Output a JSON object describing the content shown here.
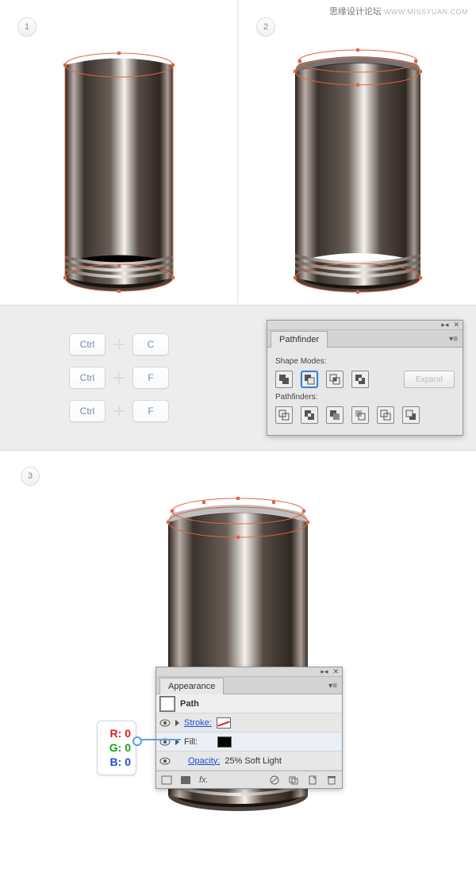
{
  "watermark": {
    "cn": "思缘设计论坛",
    "url": "WWW.MISSYUAN.COM"
  },
  "steps": {
    "one": "1",
    "two": "2",
    "three": "3"
  },
  "shortcuts": {
    "ctrl": "Ctrl",
    "c": "C",
    "f": "F"
  },
  "pathfinder": {
    "title": "Pathfinder",
    "shape_modes_label": "Shape Modes:",
    "pathfinders_label": "Pathfinders:",
    "expand": "Expand"
  },
  "appearance": {
    "title": "Appearance",
    "path": "Path",
    "stroke_label": "Stroke:",
    "fill_label": "Fill:",
    "opacity_label": "Opacity:",
    "opacity_value": "25% Soft Light",
    "fx": "fx."
  },
  "rgb": {
    "r": "R: 0",
    "g": "G: 0",
    "b": "B: 0"
  },
  "icons": {
    "collapse": "▸◂",
    "close": "✕",
    "menu": "▾≡"
  }
}
